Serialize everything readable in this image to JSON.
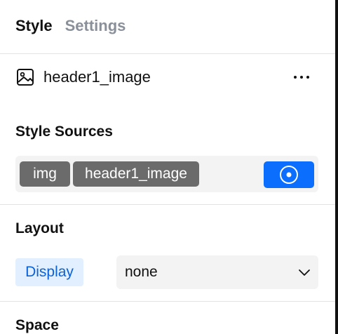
{
  "tabs": [
    {
      "label": "Style",
      "active": true
    },
    {
      "label": "Settings",
      "active": false
    }
  ],
  "element": {
    "name": "header1_image",
    "icon": "image-icon",
    "menu_icon": "more-horizontal-icon"
  },
  "style_sources": {
    "title": "Style Sources",
    "tokens": [
      "img",
      "header1_image"
    ],
    "state_icon": "target-icon"
  },
  "layout": {
    "title": "Layout",
    "display_label": "Display",
    "display_value": "none"
  },
  "space": {
    "title": "Space"
  },
  "colors": {
    "accent": "#0b6efd",
    "token_bg": "#6b6b6b",
    "label_highlight": "#e1efff"
  }
}
